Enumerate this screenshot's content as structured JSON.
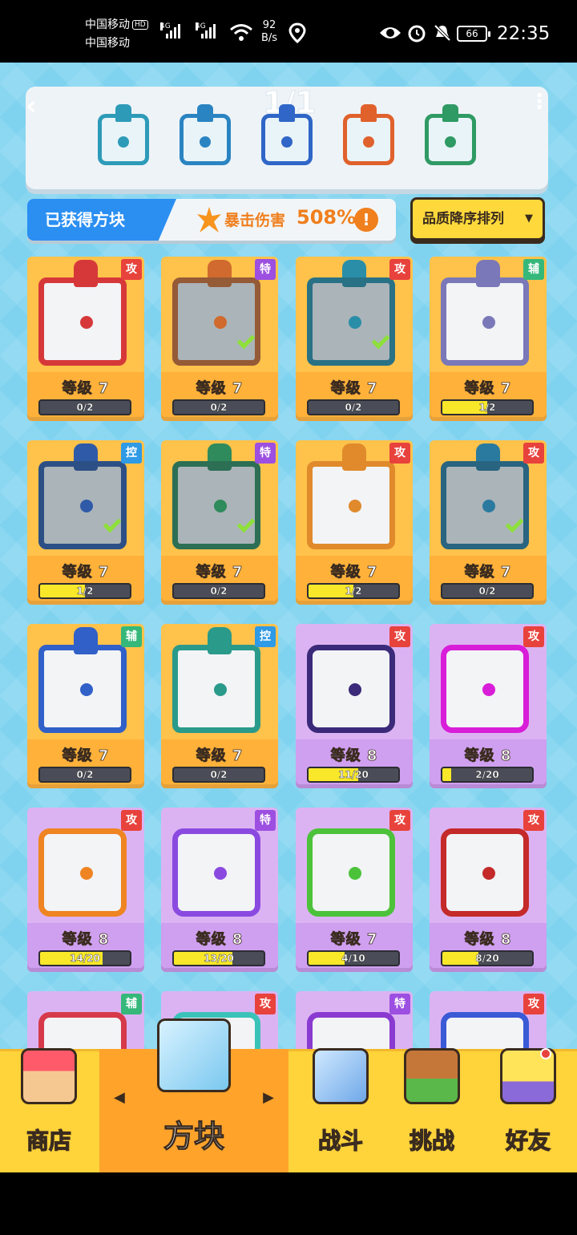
{
  "status_bar": {
    "carrier1": "中国移动",
    "carrier1_badge": "HD",
    "carrier2": "中国移动",
    "net1": "4G",
    "net2": "4G",
    "speed_value": "92",
    "speed_unit": "B/s",
    "battery": "66",
    "time": "22:35"
  },
  "deck": {
    "page": "1/1",
    "slots": [
      {
        "name": "wind-block",
        "color": "#2d9bb8"
      },
      {
        "name": "vortex-block",
        "color": "#2b84c2"
      },
      {
        "name": "snowflake-block",
        "color": "#2f66c7"
      },
      {
        "name": "infinity-block",
        "color": "#e0612c"
      },
      {
        "name": "pentagram-block",
        "color": "#2f9a64"
      }
    ]
  },
  "stats": {
    "owned_label": "已获得方块",
    "crit_label": "暴击伤害",
    "crit_value": "508%",
    "info_symbol": "!"
  },
  "sort_button": {
    "label": "品质降序排列",
    "arrow": "▼"
  },
  "cards": [
    {
      "tag": "攻",
      "tag_type": "atk",
      "level": "等级 7",
      "progress": "0/2",
      "fill": 0,
      "style": "gold",
      "color": "#d6383a",
      "checked": false,
      "dim": false
    },
    {
      "tag": "特",
      "tag_type": "spc",
      "level": "等级 7",
      "progress": "0/2",
      "fill": 0,
      "style": "gold",
      "color": "#d06a2e",
      "checked": true,
      "dim": true
    },
    {
      "tag": "攻",
      "tag_type": "atk",
      "level": "等级 7",
      "progress": "0/2",
      "fill": 0,
      "style": "gold",
      "color": "#2a8ea8",
      "checked": true,
      "dim": true
    },
    {
      "tag": "辅",
      "tag_type": "sup",
      "level": "等级 7",
      "progress": "1/2",
      "fill": 0.5,
      "style": "gold",
      "color": "#7a78b8",
      "checked": false,
      "dim": false
    },
    {
      "tag": "控",
      "tag_type": "ctl",
      "level": "等级 7",
      "progress": "1/2",
      "fill": 0.5,
      "style": "gold",
      "color": "#2f5aa8",
      "checked": true,
      "dim": true
    },
    {
      "tag": "特",
      "tag_type": "spc",
      "level": "等级 7",
      "progress": "0/2",
      "fill": 0,
      "style": "gold",
      "color": "#2f8a5c",
      "checked": true,
      "dim": true
    },
    {
      "tag": "攻",
      "tag_type": "atk",
      "level": "等级 7",
      "progress": "1/2",
      "fill": 0.5,
      "style": "gold",
      "color": "#e08a2c",
      "checked": false,
      "dim": false
    },
    {
      "tag": "攻",
      "tag_type": "atk",
      "level": "等级 7",
      "progress": "0/2",
      "fill": 0,
      "style": "gold",
      "color": "#2a7aa0",
      "checked": true,
      "dim": true
    },
    {
      "tag": "辅",
      "tag_type": "sup",
      "level": "等级 7",
      "progress": "0/2",
      "fill": 0,
      "style": "gold",
      "color": "#3060c8",
      "checked": false,
      "dim": false
    },
    {
      "tag": "控",
      "tag_type": "ctl",
      "level": "等级 7",
      "progress": "0/2",
      "fill": 0,
      "style": "gold",
      "color": "#2a9a8a",
      "checked": false,
      "dim": false
    },
    {
      "tag": "攻",
      "tag_type": "atk",
      "level": "等级 8",
      "progress": "11/20",
      "fill": 0.55,
      "style": "purple",
      "color": "#3b2a7a",
      "checked": false,
      "dim": false
    },
    {
      "tag": "攻",
      "tag_type": "atk",
      "level": "等级 8",
      "progress": "2/20",
      "fill": 0.1,
      "style": "purple",
      "color": "#d81ed8",
      "checked": false,
      "dim": false
    },
    {
      "tag": "攻",
      "tag_type": "atk",
      "level": "等级 8",
      "progress": "14/20",
      "fill": 0.7,
      "style": "purple",
      "color": "#ef8422",
      "checked": false,
      "dim": false
    },
    {
      "tag": "特",
      "tag_type": "spc",
      "level": "等级 8",
      "progress": "13/20",
      "fill": 0.65,
      "style": "purple",
      "color": "#8a4ae0",
      "checked": false,
      "dim": false
    },
    {
      "tag": "攻",
      "tag_type": "atk",
      "level": "等级 7",
      "progress": "4/10",
      "fill": 0.4,
      "style": "purple",
      "color": "#4cc23a",
      "checked": false,
      "dim": false
    },
    {
      "tag": "攻",
      "tag_type": "atk",
      "level": "等级 8",
      "progress": "8/20",
      "fill": 0.4,
      "style": "purple",
      "color": "#c42a2a",
      "checked": false,
      "dim": false
    },
    {
      "tag": "辅",
      "tag_type": "sup",
      "level": "",
      "progress": "",
      "fill": 0,
      "style": "purple",
      "color": "#d63a4a",
      "checked": false,
      "dim": false
    },
    {
      "tag": "攻",
      "tag_type": "atk",
      "level": "",
      "progress": "",
      "fill": 0,
      "style": "purple",
      "color": "#3ac2b8",
      "checked": false,
      "dim": false
    },
    {
      "tag": "特",
      "tag_type": "spc",
      "level": "",
      "progress": "",
      "fill": 0,
      "style": "purple",
      "color": "#8a3ad0",
      "checked": false,
      "dim": false
    },
    {
      "tag": "攻",
      "tag_type": "atk",
      "level": "",
      "progress": "",
      "fill": 0,
      "style": "purple",
      "color": "#3a5ad6",
      "checked": false,
      "dim": false
    }
  ],
  "tabs": {
    "shop": "商店",
    "blocks": "方块",
    "battle": "战斗",
    "challenge": "挑战",
    "friends": "好友",
    "left_arrow": "◀",
    "right_arrow": "▶"
  }
}
